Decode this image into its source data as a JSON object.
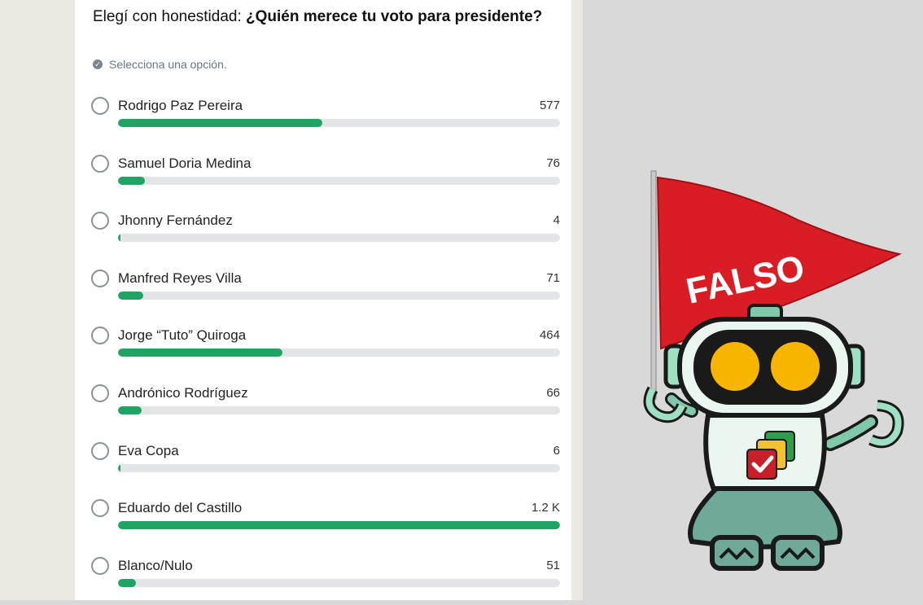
{
  "poll": {
    "title_prefix": "Elegí con honestidad:",
    "title_question": "¿Quién merece tu voto para presidente?",
    "hint": "Selecciona una opción.",
    "options": [
      {
        "label": "Rodrigo Paz Pereira",
        "count": "577",
        "fraction": 0.462
      },
      {
        "label": "Samuel Doria Medina",
        "count": "76",
        "fraction": 0.061
      },
      {
        "label": "Jhonny Fernández",
        "count": "4",
        "fraction": 0.004
      },
      {
        "label": "Manfred Reyes Villa",
        "count": "71",
        "fraction": 0.057
      },
      {
        "label": "Jorge “Tuto” Quiroga",
        "count": "464",
        "fraction": 0.372
      },
      {
        "label": "Andrónico Rodríguez",
        "count": "66",
        "fraction": 0.053
      },
      {
        "label": "Eva Copa",
        "count": "6",
        "fraction": 0.005
      },
      {
        "label": "Eduardo del Castillo",
        "count": "1.2 K",
        "fraction": 1.0
      },
      {
        "label": "Blanco/Nulo",
        "count": "51",
        "fraction": 0.041
      }
    ]
  },
  "sticker": {
    "flag_text": "FALSO",
    "flag_color": "#d81e24",
    "icon": "robot-mascot"
  },
  "colors": {
    "bar_fill": "#1fa463",
    "bar_track": "#e3e5e6"
  }
}
